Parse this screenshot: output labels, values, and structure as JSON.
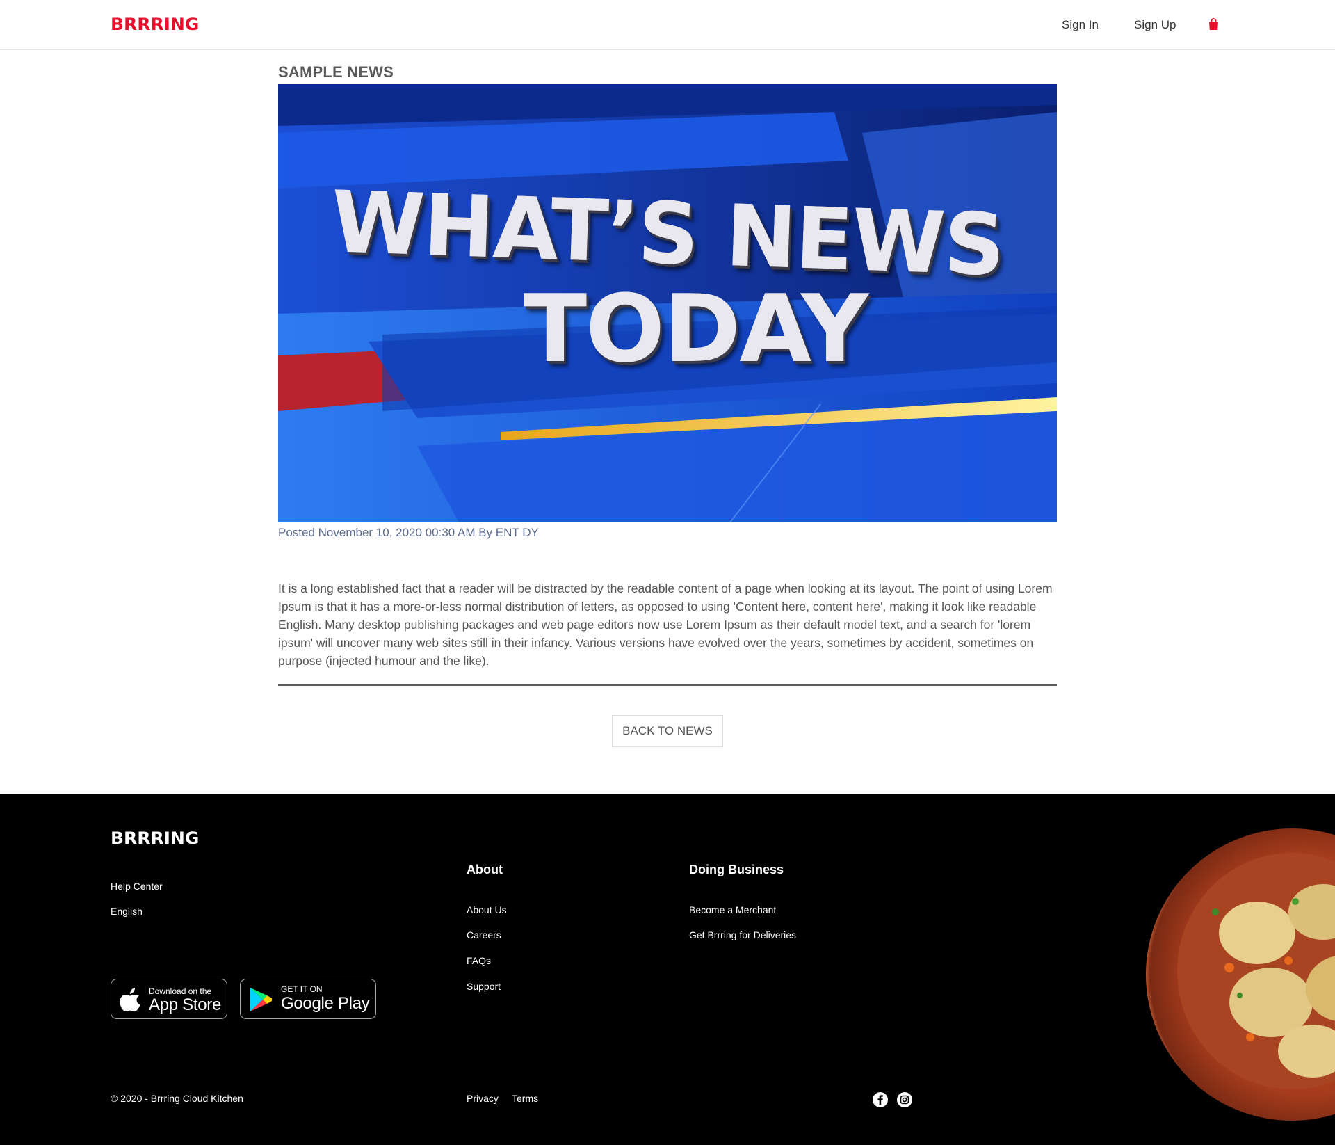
{
  "header": {
    "logo": "BRRRING",
    "nav": {
      "sign_in": "Sign In",
      "sign_up": "Sign Up"
    },
    "cart_icon": "shopping-bag-icon",
    "brand_color": "#e8112d"
  },
  "article": {
    "title": "SAMPLE NEWS",
    "hero": {
      "line1": "WHAT’S NEWS",
      "line2": "TODAY"
    },
    "meta": "Posted November 10, 2020 00:30 AM By ENT DY",
    "body": "It is a long established fact that a reader will be distracted by the readable content of a page when looking at its layout. The point of using Lorem Ipsum is that it has a more-or-less normal distribution of letters, as opposed to using 'Content here, content here', making it look like readable English. Many desktop publishing packages and web page editors now use Lorem Ipsum as their default model text, and a search for 'lorem ipsum' will uncover many web sites still in their infancy. Various versions have evolved over the years, sometimes by accident, sometimes on purpose (injected humour and the like).",
    "back_button": "BACK TO NEWS"
  },
  "footer": {
    "logo": "BRRRING",
    "left_links": {
      "help_center": "Help Center",
      "language": "English"
    },
    "about": {
      "heading": "About",
      "links": [
        "About Us",
        "Careers",
        "FAQs",
        "Support"
      ]
    },
    "business": {
      "heading": "Doing Business",
      "links": [
        "Become a Merchant",
        "Get Brrring for Deliveries"
      ]
    },
    "app_store": {
      "small": "Download on the",
      "big": "App Store",
      "icon": "apple-icon"
    },
    "google_play": {
      "small": "GET IT ON",
      "big": "Google Play",
      "icon": "google-play-icon"
    },
    "copyright": "© 2020 - Brrring Cloud Kitchen",
    "legal": {
      "privacy": "Privacy",
      "terms": "Terms"
    },
    "social": [
      "facebook-icon",
      "instagram-icon"
    ]
  }
}
